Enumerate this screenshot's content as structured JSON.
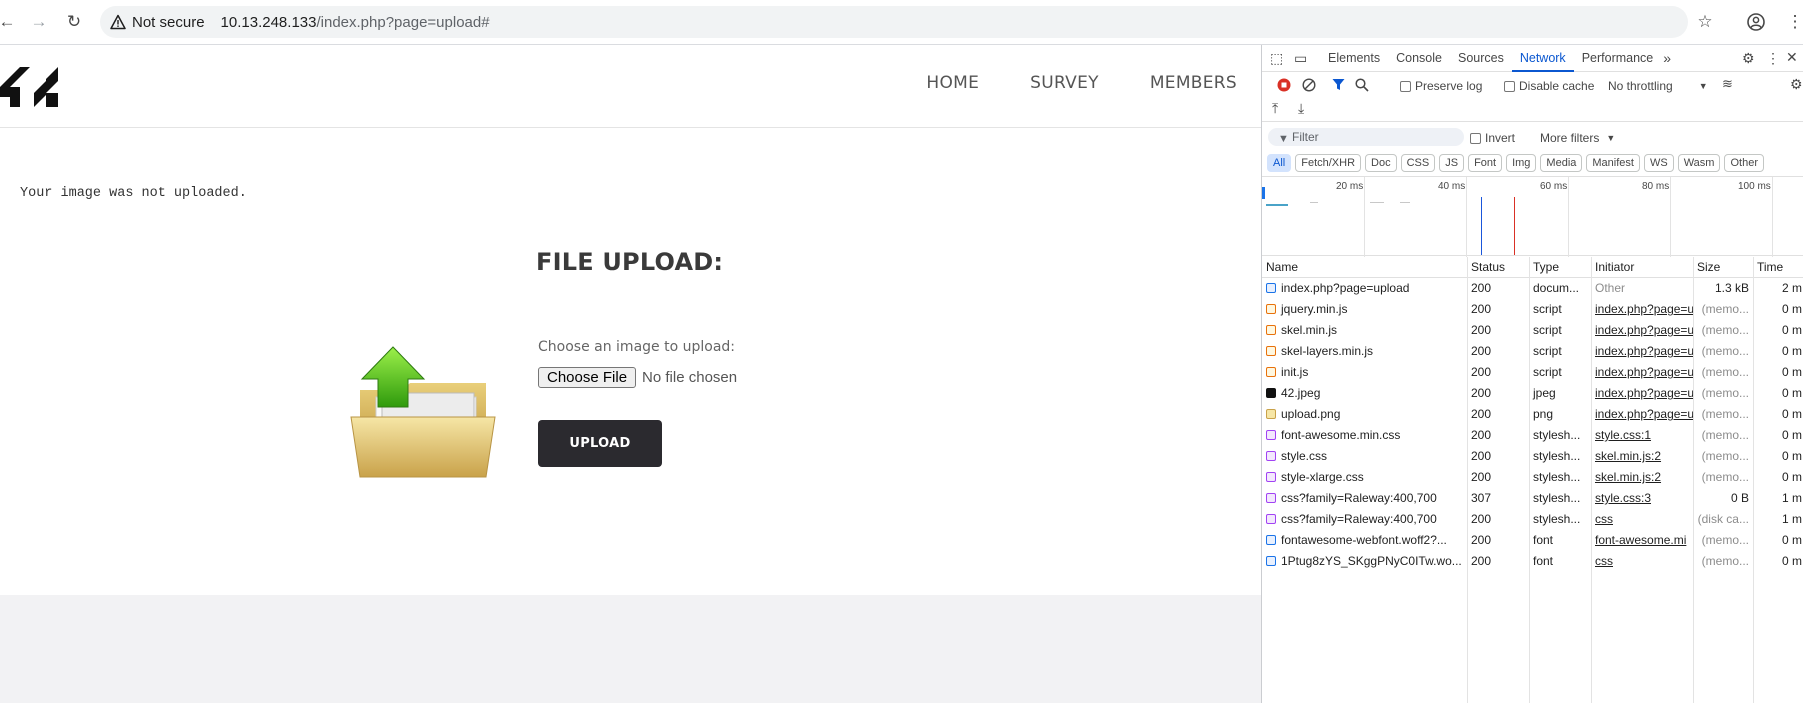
{
  "browser": {
    "not_secure": "Not secure",
    "url_host": "10.13.248.133",
    "url_path": "/index.php?page=upload#"
  },
  "site": {
    "logo_text": "42",
    "nav": [
      "HOME",
      "SURVEY",
      "MEMBERS"
    ],
    "message": "Your image was not uploaded.",
    "title": "FILE UPLOAD:",
    "choose_label": "Choose an image to upload:",
    "file_button": "Choose File",
    "file_status": "No file chosen",
    "upload_button": "UPLOAD"
  },
  "devtools": {
    "tabs": [
      "Elements",
      "Console",
      "Sources",
      "Network",
      "Performance"
    ],
    "active_tab": "Network",
    "preserve_log": "Preserve log",
    "disable_cache": "Disable cache",
    "throttling": "No throttling",
    "filter_placeholder": "Filter",
    "invert": "Invert",
    "more_filters": "More filters",
    "type_filters": [
      "All",
      "Fetch/XHR",
      "Doc",
      "CSS",
      "JS",
      "Font",
      "Img",
      "Media",
      "Manifest",
      "WS",
      "Wasm",
      "Other"
    ],
    "timeline_labels": [
      "20 ms",
      "40 ms",
      "60 ms",
      "80 ms",
      "100 ms"
    ],
    "columns": [
      "Name",
      "Status",
      "Type",
      "Initiator",
      "Size",
      "Time"
    ],
    "requests": [
      {
        "name": "index.php?page=upload",
        "status": "200",
        "type": "docum...",
        "initiator": "Other",
        "size": "1.3 kB",
        "time": "2 m",
        "icon": "doc"
      },
      {
        "name": "jquery.min.js",
        "status": "200",
        "type": "script",
        "initiator": "index.php?page=u",
        "size": "(memo...",
        "time": "0 m",
        "icon": "script"
      },
      {
        "name": "skel.min.js",
        "status": "200",
        "type": "script",
        "initiator": "index.php?page=u",
        "size": "(memo...",
        "time": "0 m",
        "icon": "script"
      },
      {
        "name": "skel-layers.min.js",
        "status": "200",
        "type": "script",
        "initiator": "index.php?page=u",
        "size": "(memo...",
        "time": "0 m",
        "icon": "script"
      },
      {
        "name": "init.js",
        "status": "200",
        "type": "script",
        "initiator": "index.php?page=u",
        "size": "(memo...",
        "time": "0 m",
        "icon": "script"
      },
      {
        "name": "42.jpeg",
        "status": "200",
        "type": "jpeg",
        "initiator": "index.php?page=u",
        "size": "(memo...",
        "time": "0 m",
        "icon": "img42"
      },
      {
        "name": "upload.png",
        "status": "200",
        "type": "png",
        "initiator": "index.php?page=u",
        "size": "(memo...",
        "time": "0 m",
        "icon": "imgfolder"
      },
      {
        "name": "font-awesome.min.css",
        "status": "200",
        "type": "stylesh...",
        "initiator": "style.css:1",
        "size": "(memo...",
        "time": "0 m",
        "icon": "css"
      },
      {
        "name": "style.css",
        "status": "200",
        "type": "stylesh...",
        "initiator": "skel.min.js:2",
        "size": "(memo...",
        "time": "0 m",
        "icon": "css"
      },
      {
        "name": "style-xlarge.css",
        "status": "200",
        "type": "stylesh...",
        "initiator": "skel.min.js:2",
        "size": "(memo...",
        "time": "0 m",
        "icon": "css"
      },
      {
        "name": "css?family=Raleway:400,700",
        "status": "307",
        "type": "stylesh...",
        "initiator": "style.css:3",
        "size": "0 B",
        "time": "1 m",
        "icon": "css"
      },
      {
        "name": "css?family=Raleway:400,700",
        "status": "200",
        "type": "stylesh...",
        "initiator": "css",
        "size": "(disk ca...",
        "time": "1 m",
        "icon": "css"
      },
      {
        "name": "fontawesome-webfont.woff2?...",
        "status": "200",
        "type": "font",
        "initiator": "font-awesome.mi",
        "size": "(memo...",
        "time": "0 m",
        "icon": "font"
      },
      {
        "name": "1Ptug8zYS_SKggPNyC0ITw.wo...",
        "status": "200",
        "type": "font",
        "initiator": "css",
        "size": "(memo...",
        "time": "0 m",
        "icon": "font"
      }
    ]
  },
  "colors": {
    "accent": "#0b57d0",
    "record": "#d93025",
    "upload_button": "#2b2a2f"
  }
}
